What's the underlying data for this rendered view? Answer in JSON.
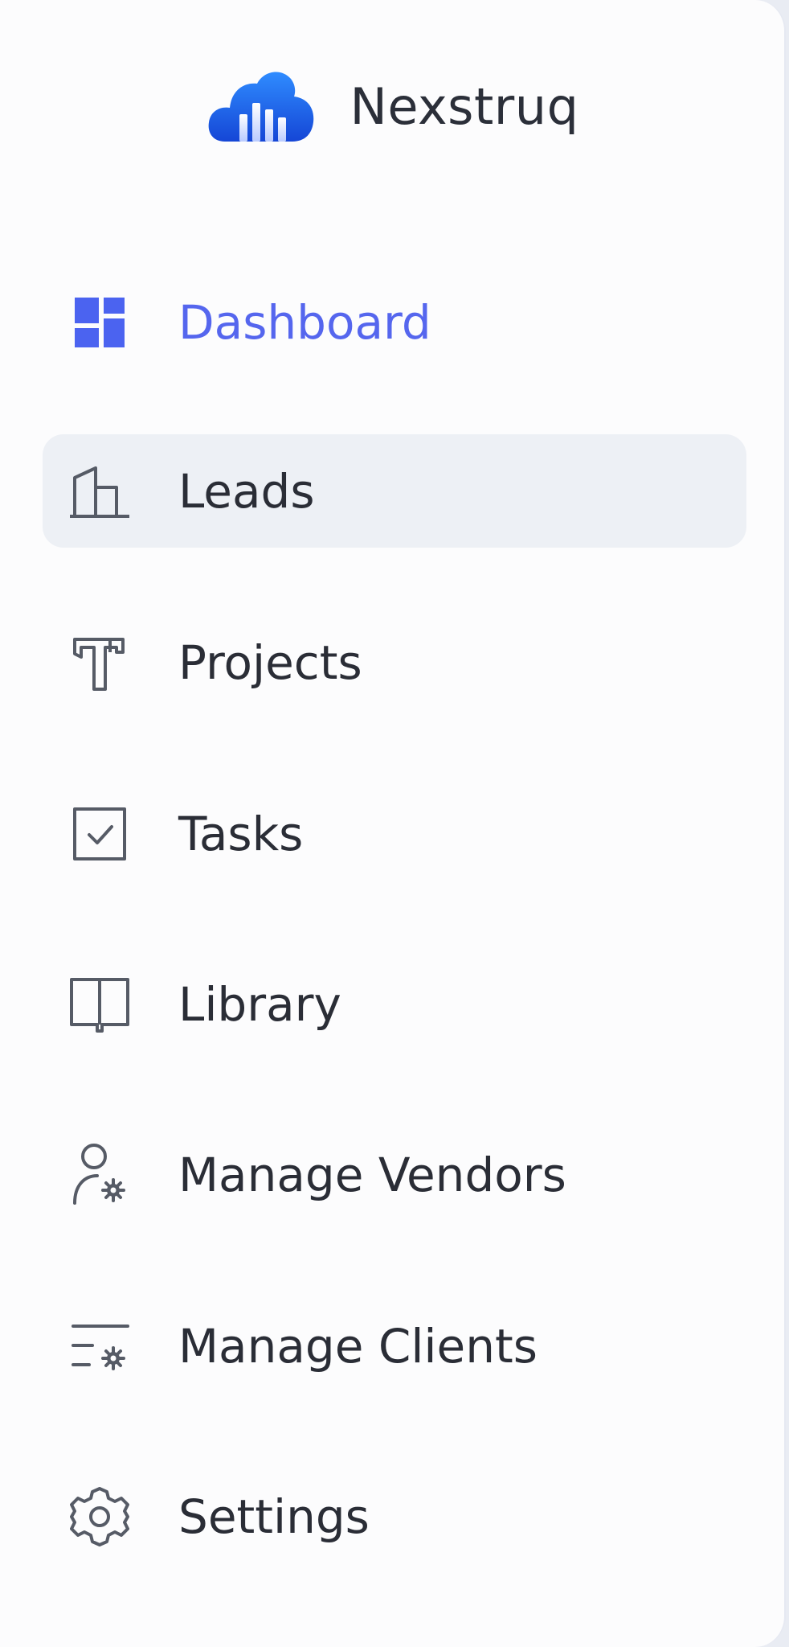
{
  "brand": {
    "name": "Nexstruq",
    "logo_icon": "cloud-bars-logo"
  },
  "nav": {
    "active": "Dashboard",
    "hovered": "Leads",
    "items": [
      {
        "label": "Dashboard",
        "icon": "dashboard-grid-icon"
      },
      {
        "label": "Leads",
        "icon": "building-icon"
      },
      {
        "label": "Projects",
        "icon": "hammer-icon"
      },
      {
        "label": "Tasks",
        "icon": "checkbox-icon"
      },
      {
        "label": "Library",
        "icon": "book-icon"
      },
      {
        "label": "Manage Vendors",
        "icon": "user-gear-icon"
      },
      {
        "label": "Manage Clients",
        "icon": "list-gear-icon"
      },
      {
        "label": "Settings",
        "icon": "gear-icon"
      }
    ]
  },
  "colors": {
    "accent": "#5566ee",
    "text": "#2a2d36",
    "icon": "#565b66",
    "hover_bg": "#edf0f5",
    "panel_bg": "#fcfcfd"
  }
}
